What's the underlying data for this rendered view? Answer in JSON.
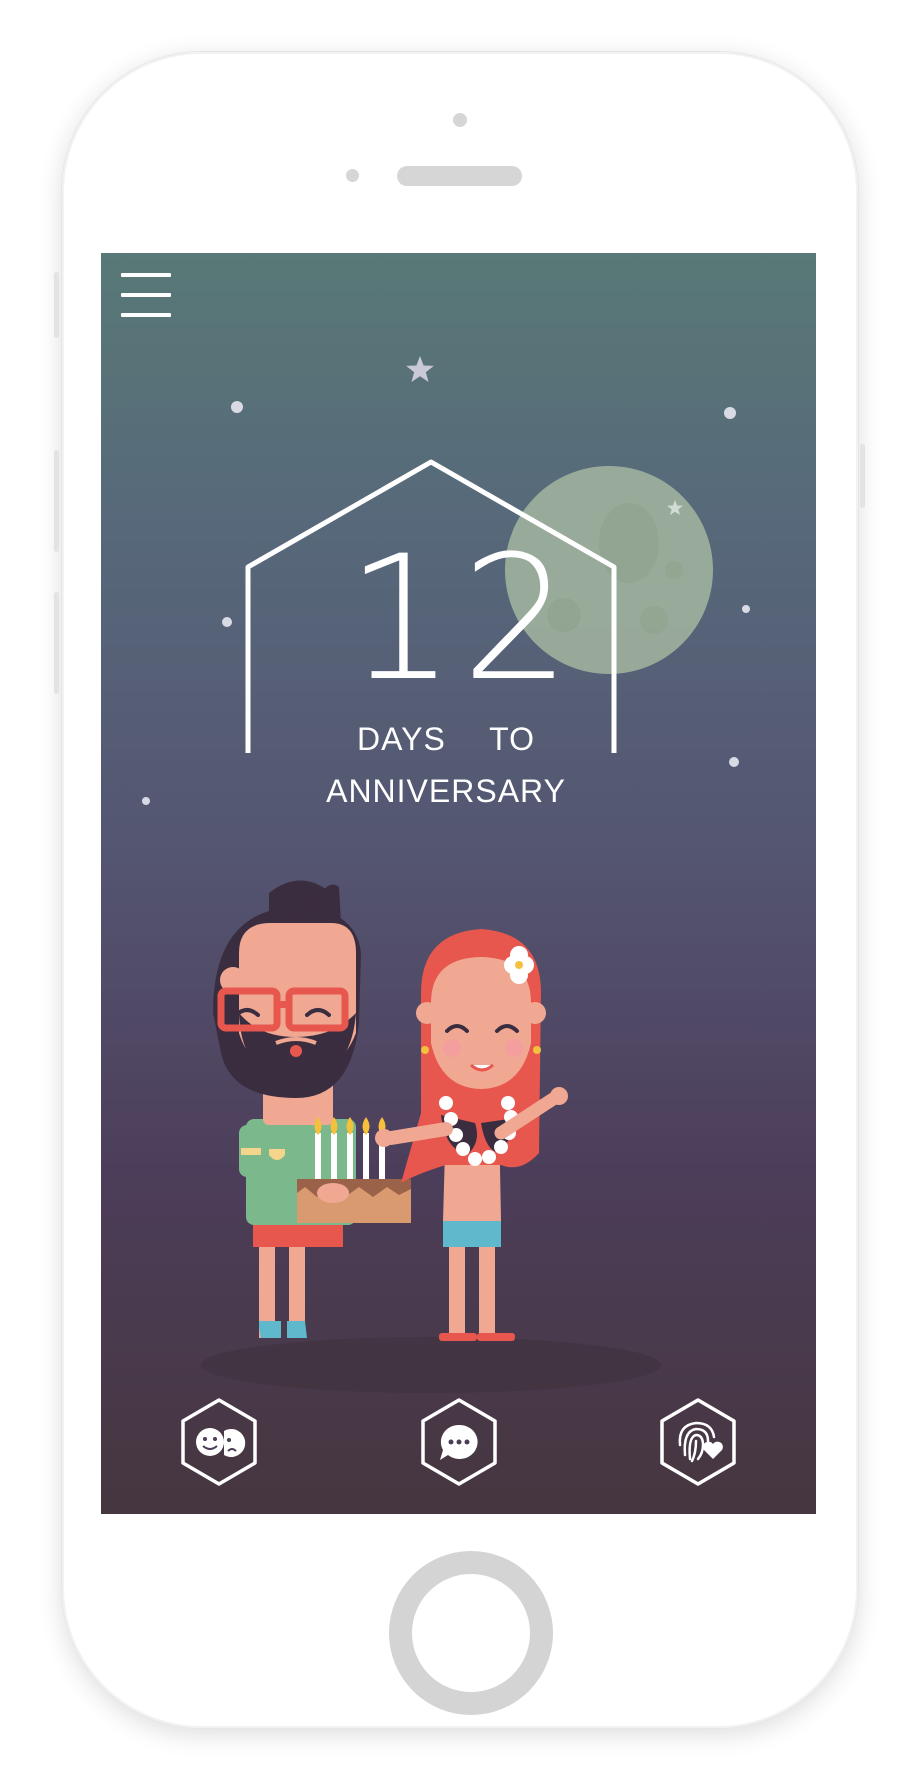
{
  "countdown": {
    "number": "12",
    "line1": "DAYS TO",
    "line2": "ANNIVERSARY"
  },
  "icons": {
    "menu": "hamburger-menu-icon",
    "nav_left": "emoji-faces-icon",
    "nav_center": "chat-bubble-icon",
    "nav_right": "fingerprint-heart-icon"
  },
  "colors": {
    "sky_top": "#587977",
    "sky_bottom": "#46363f",
    "outline": "#ffffff",
    "moon": "#a3b6a0"
  }
}
